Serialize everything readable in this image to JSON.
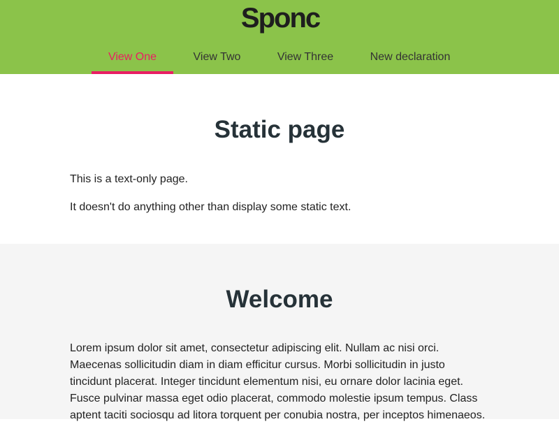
{
  "header": {
    "logo_text": "Sponc",
    "background": "#8bc34a"
  },
  "nav": {
    "accent_color": "#e91e63",
    "tabs": [
      {
        "label": "View One",
        "active": true
      },
      {
        "label": "View Two",
        "active": false
      },
      {
        "label": "View Three",
        "active": false
      },
      {
        "label": "New declaration",
        "active": false
      }
    ]
  },
  "static_section": {
    "title": "Static page",
    "paragraphs": [
      "This is a text-only page.",
      "It doesn't do anything other than display some static text."
    ]
  },
  "welcome_section": {
    "title": "Welcome",
    "body": "Lorem ipsum dolor sit amet, consectetur adipiscing elit. Nullam ac nisi orci. Maecenas sollicitudin diam in diam efficitur cursus. Morbi sollicitudin in justo tincidunt placerat. Integer tincidunt elementum nisi, eu ornare dolor lacinia eget. Fusce pulvinar massa eget odio placerat, commodo molestie ipsum tempus. Class aptent taciti sociosqu ad litora torquent per conubia nostra, per inceptos himenaeos."
  }
}
